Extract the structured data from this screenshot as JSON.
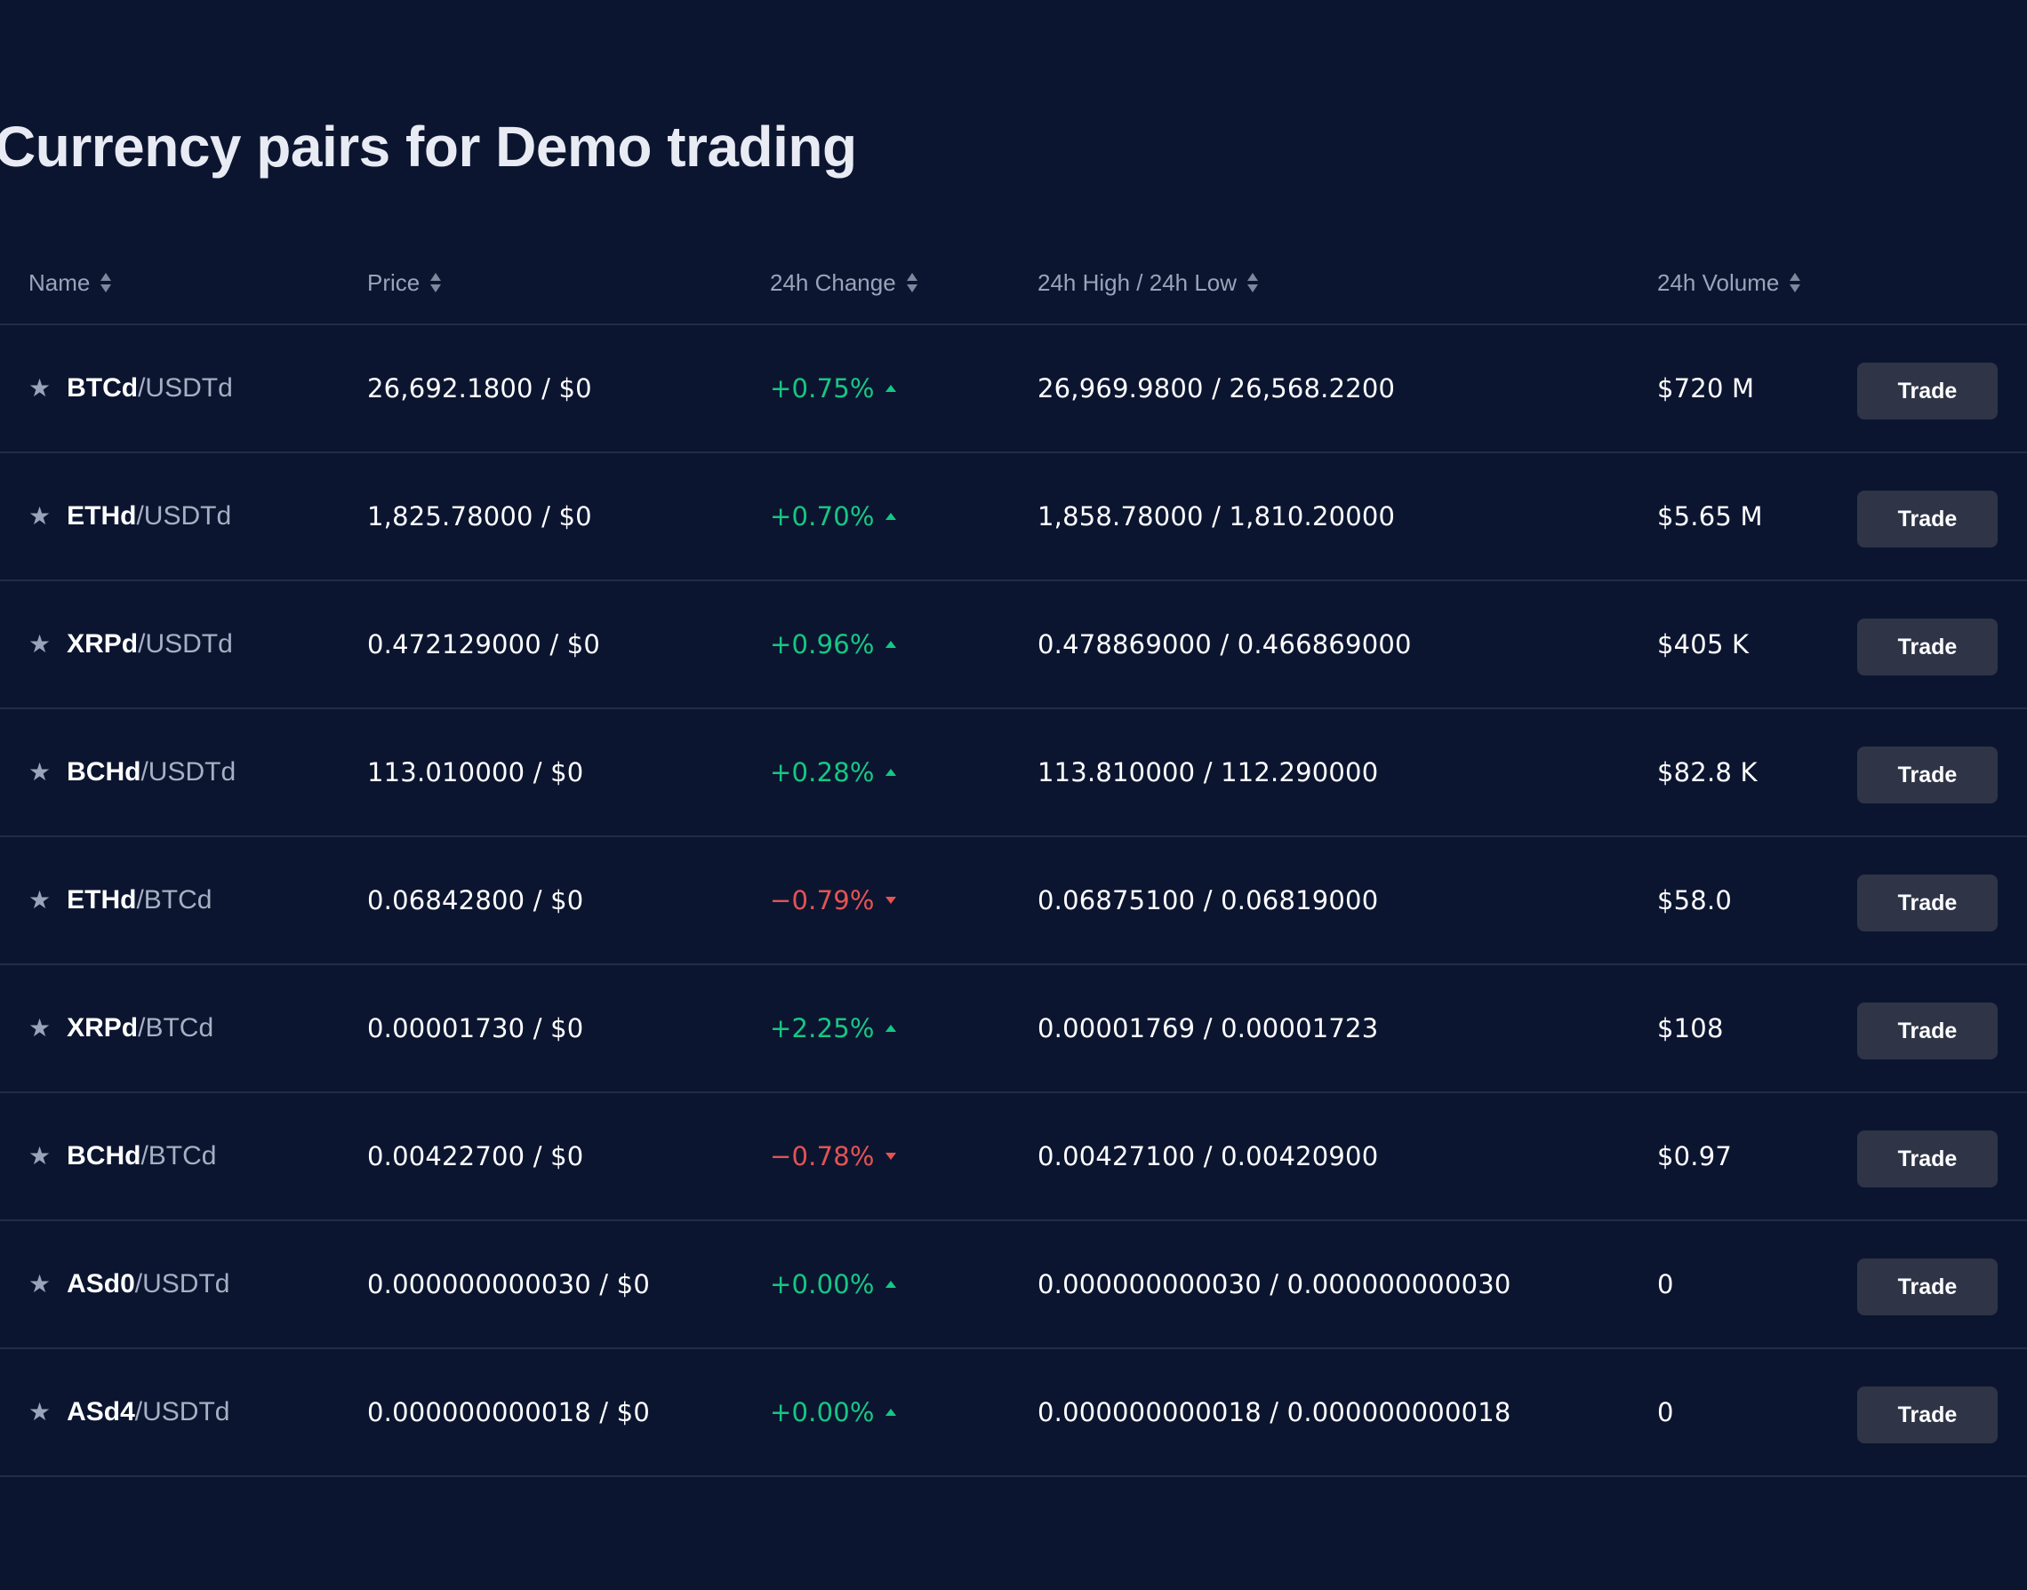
{
  "title": "Currency pairs for Demo trading",
  "columns": {
    "name": "Name",
    "price": "Price",
    "change": "24h Change",
    "high_low": "24h High / 24h Low",
    "volume": "24h Volume"
  },
  "colors": {
    "up": "#16c784",
    "down": "#e55353",
    "background": "#0c1530",
    "button": "#2f3547"
  },
  "rows": [
    {
      "base": "BTCd",
      "quote": "/USDTd",
      "price": "26,692.1800 / $0",
      "change": "+0.75%",
      "direction": "up",
      "high_low": "26,969.9800 / 26,568.2200",
      "volume": "$720 M",
      "action": "Trade"
    },
    {
      "base": "ETHd",
      "quote": "/USDTd",
      "price": "1,825.78000 / $0",
      "change": "+0.70%",
      "direction": "up",
      "high_low": "1,858.78000 / 1,810.20000",
      "volume": "$5.65 M",
      "action": "Trade"
    },
    {
      "base": "XRPd",
      "quote": "/USDTd",
      "price": "0.472129000 / $0",
      "change": "+0.96%",
      "direction": "up",
      "high_low": "0.478869000 / 0.466869000",
      "volume": "$405 K",
      "action": "Trade"
    },
    {
      "base": "BCHd",
      "quote": "/USDTd",
      "price": "113.010000 / $0",
      "change": "+0.28%",
      "direction": "up",
      "high_low": "113.810000 / 112.290000",
      "volume": "$82.8 K",
      "action": "Trade"
    },
    {
      "base": "ETHd",
      "quote": "/BTCd",
      "price": "0.06842800 / $0",
      "change": "−0.79%",
      "direction": "down",
      "high_low": "0.06875100 / 0.06819000",
      "volume": "$58.0",
      "action": "Trade"
    },
    {
      "base": "XRPd",
      "quote": "/BTCd",
      "price": "0.00001730 / $0",
      "change": "+2.25%",
      "direction": "up",
      "high_low": "0.00001769 / 0.00001723",
      "volume": "$108",
      "action": "Trade"
    },
    {
      "base": "BCHd",
      "quote": "/BTCd",
      "price": "0.00422700 / $0",
      "change": "−0.78%",
      "direction": "down",
      "high_low": "0.00427100 / 0.00420900",
      "volume": "$0.97",
      "action": "Trade"
    },
    {
      "base": "ASd0",
      "quote": "/USDTd",
      "price": "0.000000000030 / $0",
      "change": "+0.00%",
      "direction": "up",
      "high_low": "0.000000000030 / 0.000000000030",
      "volume": "0",
      "action": "Trade"
    },
    {
      "base": "ASd4",
      "quote": "/USDTd",
      "price": "0.000000000018 / $0",
      "change": "+0.00%",
      "direction": "up",
      "high_low": "0.000000000018 / 0.000000000018",
      "volume": "0",
      "action": "Trade"
    }
  ]
}
